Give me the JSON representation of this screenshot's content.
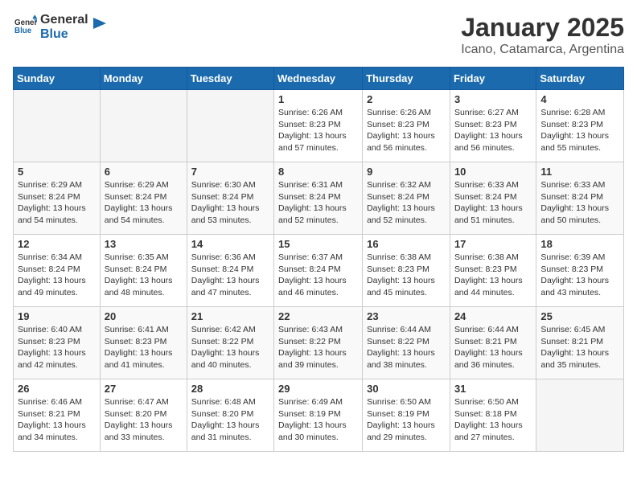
{
  "header": {
    "logo_general": "General",
    "logo_blue": "Blue",
    "title": "January 2025",
    "subtitle": "Icano, Catamarca, Argentina"
  },
  "weekdays": [
    "Sunday",
    "Monday",
    "Tuesday",
    "Wednesday",
    "Thursday",
    "Friday",
    "Saturday"
  ],
  "weeks": [
    [
      {
        "day": "",
        "info": ""
      },
      {
        "day": "",
        "info": ""
      },
      {
        "day": "",
        "info": ""
      },
      {
        "day": "1",
        "info": "Sunrise: 6:26 AM\nSunset: 8:23 PM\nDaylight: 13 hours\nand 57 minutes."
      },
      {
        "day": "2",
        "info": "Sunrise: 6:26 AM\nSunset: 8:23 PM\nDaylight: 13 hours\nand 56 minutes."
      },
      {
        "day": "3",
        "info": "Sunrise: 6:27 AM\nSunset: 8:23 PM\nDaylight: 13 hours\nand 56 minutes."
      },
      {
        "day": "4",
        "info": "Sunrise: 6:28 AM\nSunset: 8:23 PM\nDaylight: 13 hours\nand 55 minutes."
      }
    ],
    [
      {
        "day": "5",
        "info": "Sunrise: 6:29 AM\nSunset: 8:24 PM\nDaylight: 13 hours\nand 54 minutes."
      },
      {
        "day": "6",
        "info": "Sunrise: 6:29 AM\nSunset: 8:24 PM\nDaylight: 13 hours\nand 54 minutes."
      },
      {
        "day": "7",
        "info": "Sunrise: 6:30 AM\nSunset: 8:24 PM\nDaylight: 13 hours\nand 53 minutes."
      },
      {
        "day": "8",
        "info": "Sunrise: 6:31 AM\nSunset: 8:24 PM\nDaylight: 13 hours\nand 52 minutes."
      },
      {
        "day": "9",
        "info": "Sunrise: 6:32 AM\nSunset: 8:24 PM\nDaylight: 13 hours\nand 52 minutes."
      },
      {
        "day": "10",
        "info": "Sunrise: 6:33 AM\nSunset: 8:24 PM\nDaylight: 13 hours\nand 51 minutes."
      },
      {
        "day": "11",
        "info": "Sunrise: 6:33 AM\nSunset: 8:24 PM\nDaylight: 13 hours\nand 50 minutes."
      }
    ],
    [
      {
        "day": "12",
        "info": "Sunrise: 6:34 AM\nSunset: 8:24 PM\nDaylight: 13 hours\nand 49 minutes."
      },
      {
        "day": "13",
        "info": "Sunrise: 6:35 AM\nSunset: 8:24 PM\nDaylight: 13 hours\nand 48 minutes."
      },
      {
        "day": "14",
        "info": "Sunrise: 6:36 AM\nSunset: 8:24 PM\nDaylight: 13 hours\nand 47 minutes."
      },
      {
        "day": "15",
        "info": "Sunrise: 6:37 AM\nSunset: 8:24 PM\nDaylight: 13 hours\nand 46 minutes."
      },
      {
        "day": "16",
        "info": "Sunrise: 6:38 AM\nSunset: 8:23 PM\nDaylight: 13 hours\nand 45 minutes."
      },
      {
        "day": "17",
        "info": "Sunrise: 6:38 AM\nSunset: 8:23 PM\nDaylight: 13 hours\nand 44 minutes."
      },
      {
        "day": "18",
        "info": "Sunrise: 6:39 AM\nSunset: 8:23 PM\nDaylight: 13 hours\nand 43 minutes."
      }
    ],
    [
      {
        "day": "19",
        "info": "Sunrise: 6:40 AM\nSunset: 8:23 PM\nDaylight: 13 hours\nand 42 minutes."
      },
      {
        "day": "20",
        "info": "Sunrise: 6:41 AM\nSunset: 8:23 PM\nDaylight: 13 hours\nand 41 minutes."
      },
      {
        "day": "21",
        "info": "Sunrise: 6:42 AM\nSunset: 8:22 PM\nDaylight: 13 hours\nand 40 minutes."
      },
      {
        "day": "22",
        "info": "Sunrise: 6:43 AM\nSunset: 8:22 PM\nDaylight: 13 hours\nand 39 minutes."
      },
      {
        "day": "23",
        "info": "Sunrise: 6:44 AM\nSunset: 8:22 PM\nDaylight: 13 hours\nand 38 minutes."
      },
      {
        "day": "24",
        "info": "Sunrise: 6:44 AM\nSunset: 8:21 PM\nDaylight: 13 hours\nand 36 minutes."
      },
      {
        "day": "25",
        "info": "Sunrise: 6:45 AM\nSunset: 8:21 PM\nDaylight: 13 hours\nand 35 minutes."
      }
    ],
    [
      {
        "day": "26",
        "info": "Sunrise: 6:46 AM\nSunset: 8:21 PM\nDaylight: 13 hours\nand 34 minutes."
      },
      {
        "day": "27",
        "info": "Sunrise: 6:47 AM\nSunset: 8:20 PM\nDaylight: 13 hours\nand 33 minutes."
      },
      {
        "day": "28",
        "info": "Sunrise: 6:48 AM\nSunset: 8:20 PM\nDaylight: 13 hours\nand 31 minutes."
      },
      {
        "day": "29",
        "info": "Sunrise: 6:49 AM\nSunset: 8:19 PM\nDaylight: 13 hours\nand 30 minutes."
      },
      {
        "day": "30",
        "info": "Sunrise: 6:50 AM\nSunset: 8:19 PM\nDaylight: 13 hours\nand 29 minutes."
      },
      {
        "day": "31",
        "info": "Sunrise: 6:50 AM\nSunset: 8:18 PM\nDaylight: 13 hours\nand 27 minutes."
      },
      {
        "day": "",
        "info": ""
      }
    ]
  ]
}
